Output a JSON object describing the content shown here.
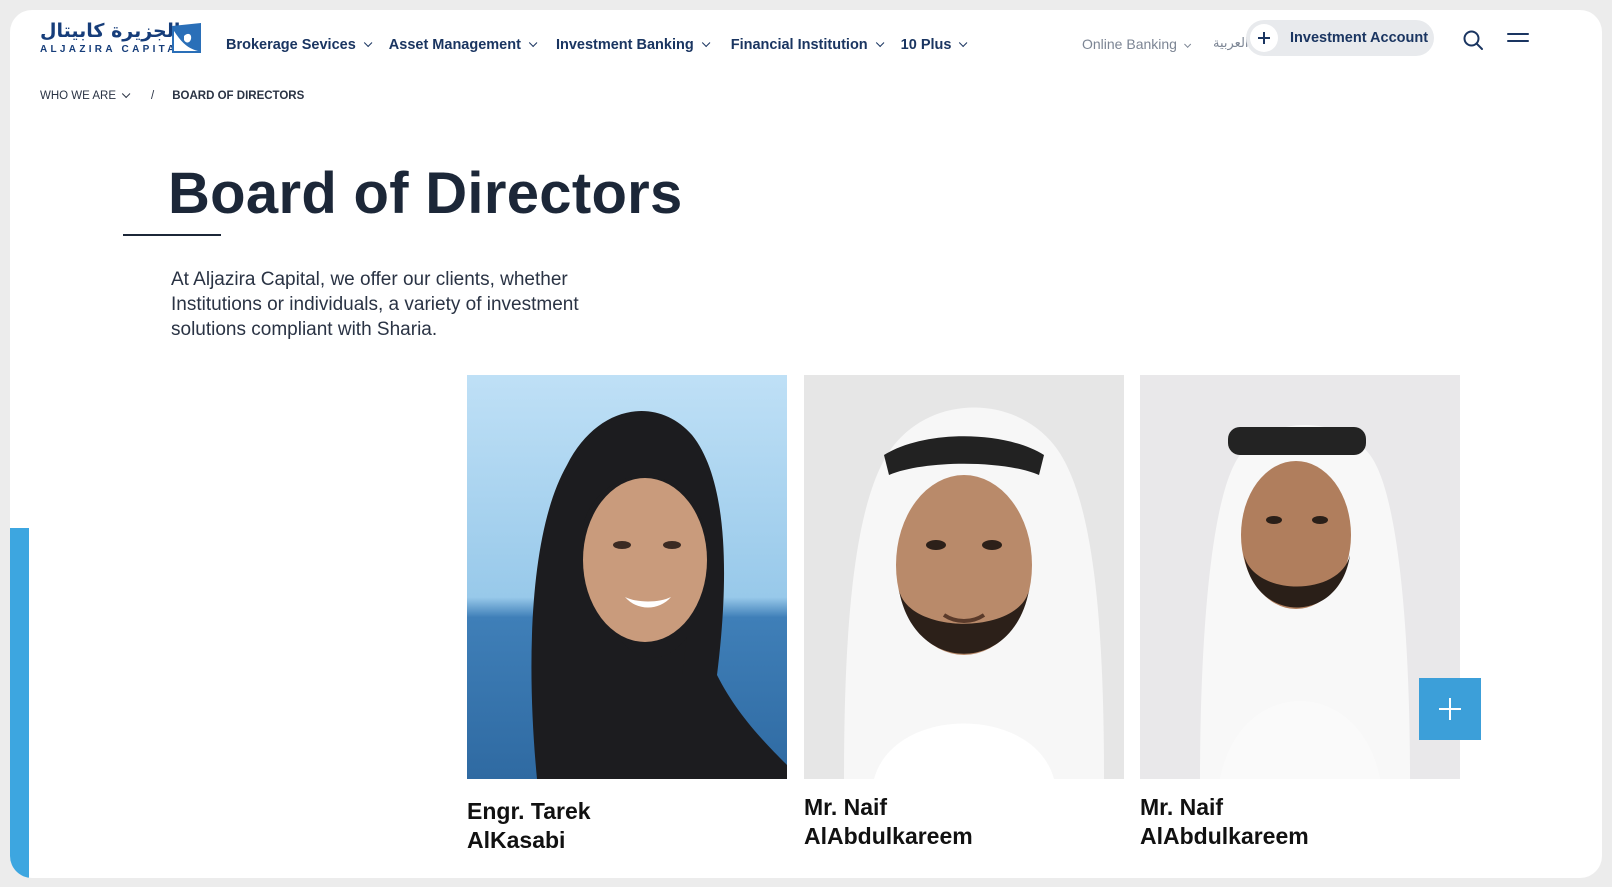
{
  "brand": {
    "logo_arabic": "الجزيرة كابيتال",
    "logo_english": "ALJAZIRA CAPITAL"
  },
  "nav": {
    "items": [
      {
        "label": "Brokerage Sevices"
      },
      {
        "label": "Asset Management"
      },
      {
        "label": "Investment Banking"
      },
      {
        "label": "Financial Institution"
      },
      {
        "label": "10 Plus"
      }
    ],
    "online_banking": "Online Banking",
    "language": "العربية",
    "investment_account": "Investment Account"
  },
  "breadcrumb": {
    "parent": "WHO WE ARE",
    "separator": "/",
    "current": "BOARD OF DIRECTORS"
  },
  "page": {
    "title": "Board of Directors",
    "intro": "At Aljazira Capital, we offer our clients, whether Institutions or individuals, a variety of investment solutions compliant with Sharia."
  },
  "directors": [
    {
      "name_line1": "Engr. Tarek",
      "name_line2": "AlKasabi"
    },
    {
      "name_line1": "Mr. Naif",
      "name_line2": "AlAbdulkareem"
    },
    {
      "name_line1": "Mr. Naif",
      "name_line2": "AlAbdulkareem"
    }
  ],
  "colors": {
    "brand_navy": "#1a3561",
    "accent_blue": "#3da6e0",
    "plus_tile": "#3c9fd9"
  },
  "icons": [
    "search-icon",
    "menu-icon",
    "plus-icon",
    "chevron-down-icon"
  ]
}
